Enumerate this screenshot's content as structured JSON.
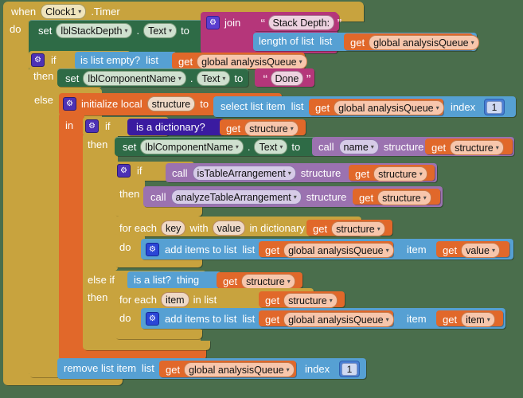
{
  "app": {
    "name": "MIT App Inventor Blocks Editor",
    "workspace_background": "#4a6e4c"
  },
  "colors": {
    "event": "#c8a33e",
    "control": "#c8a33e",
    "setter": "#2e6b46",
    "text": "#b5367a",
    "list": "#56a0d3",
    "variable": "#e1682a",
    "procedure": "#9b72b0",
    "dictionary": "#3a1ba0",
    "math": "#4a7fd4",
    "local": "#e1682a"
  },
  "blocks": {
    "event": {
      "when": "when",
      "component": "Clock1",
      "event_name": ".Timer",
      "do": "do"
    },
    "set_stack_depth": {
      "set": "set",
      "component": "lblStackDepth",
      "dot": ".",
      "property": "Text",
      "to": "to"
    },
    "join": {
      "label": "join"
    },
    "text_stack_depth": {
      "value": "Stack Depth:"
    },
    "length_of_list": {
      "label": "length of list",
      "arg": "list"
    },
    "get_queue_1": {
      "get": "get",
      "variable": "global analysisQueue"
    },
    "if_empty": {
      "if": "if",
      "then": "then",
      "else": "else"
    },
    "is_list_empty": {
      "label": "is list empty?",
      "arg": "list"
    },
    "get_queue_2": {
      "get": "get",
      "variable": "global analysisQueue"
    },
    "set_component_name_done": {
      "set": "set",
      "component": "lblComponentName",
      "dot": ".",
      "property": "Text",
      "to": "to"
    },
    "text_done": {
      "value": "Done"
    },
    "init_local": {
      "label": "initialize local",
      "name": "structure",
      "to": "to",
      "in": "in"
    },
    "select_list_item": {
      "label": "select list item",
      "list_arg": "list",
      "index_arg": "index",
      "index_value": "1"
    },
    "get_queue_3": {
      "get": "get",
      "variable": "global analysisQueue"
    },
    "inner_if": {
      "if": "if",
      "then": "then",
      "else_if": "else if",
      "else_then": "then"
    },
    "is_a_dictionary": {
      "label": "is a dictionary?"
    },
    "get_structure_1": {
      "get": "get",
      "variable": "structure"
    },
    "set_component_name_call": {
      "set": "set",
      "component": "lblComponentName",
      "dot": ".",
      "property": "Text",
      "to": "to"
    },
    "call_name": {
      "call": "call",
      "procedure": "name",
      "arg": "structure"
    },
    "get_structure_2": {
      "get": "get",
      "variable": "structure"
    },
    "if_table": {
      "if": "if",
      "then": "then"
    },
    "call_is_table": {
      "call": "call",
      "procedure": "isTableArrangement",
      "arg": "structure"
    },
    "get_structure_3": {
      "get": "get",
      "variable": "structure"
    },
    "call_analyze_table": {
      "call": "call",
      "procedure": "analyzeTableArrangement",
      "arg": "structure"
    },
    "get_structure_4": {
      "get": "get",
      "variable": "structure"
    },
    "for_each_dict": {
      "for_each": "for each",
      "key": "key",
      "with": "with",
      "value": "value",
      "in_dictionary": "in dictionary",
      "do": "do"
    },
    "get_structure_5": {
      "get": "get",
      "variable": "structure"
    },
    "add_items_1": {
      "label": "add items to list",
      "list_arg": "list",
      "item_arg": "item"
    },
    "get_queue_4": {
      "get": "get",
      "variable": "global analysisQueue"
    },
    "get_value": {
      "get": "get",
      "variable": "value"
    },
    "is_a_list": {
      "label": "is a list?",
      "arg": "thing"
    },
    "get_structure_6": {
      "get": "get",
      "variable": "structure"
    },
    "for_each_item": {
      "for_each": "for each",
      "item": "item",
      "in_list": "in list",
      "do": "do"
    },
    "get_structure_7": {
      "get": "get",
      "variable": "structure"
    },
    "add_items_2": {
      "label": "add items to list",
      "list_arg": "list",
      "item_arg": "item"
    },
    "get_queue_5": {
      "get": "get",
      "variable": "global analysisQueue"
    },
    "get_item": {
      "get": "get",
      "variable": "item"
    },
    "remove_list_item": {
      "label": "remove list item",
      "list_arg": "list",
      "index_arg": "index",
      "index_value": "1"
    },
    "get_queue_6": {
      "get": "get",
      "variable": "global analysisQueue"
    }
  },
  "icons": {
    "gear": "⚙",
    "caret": "▾"
  }
}
